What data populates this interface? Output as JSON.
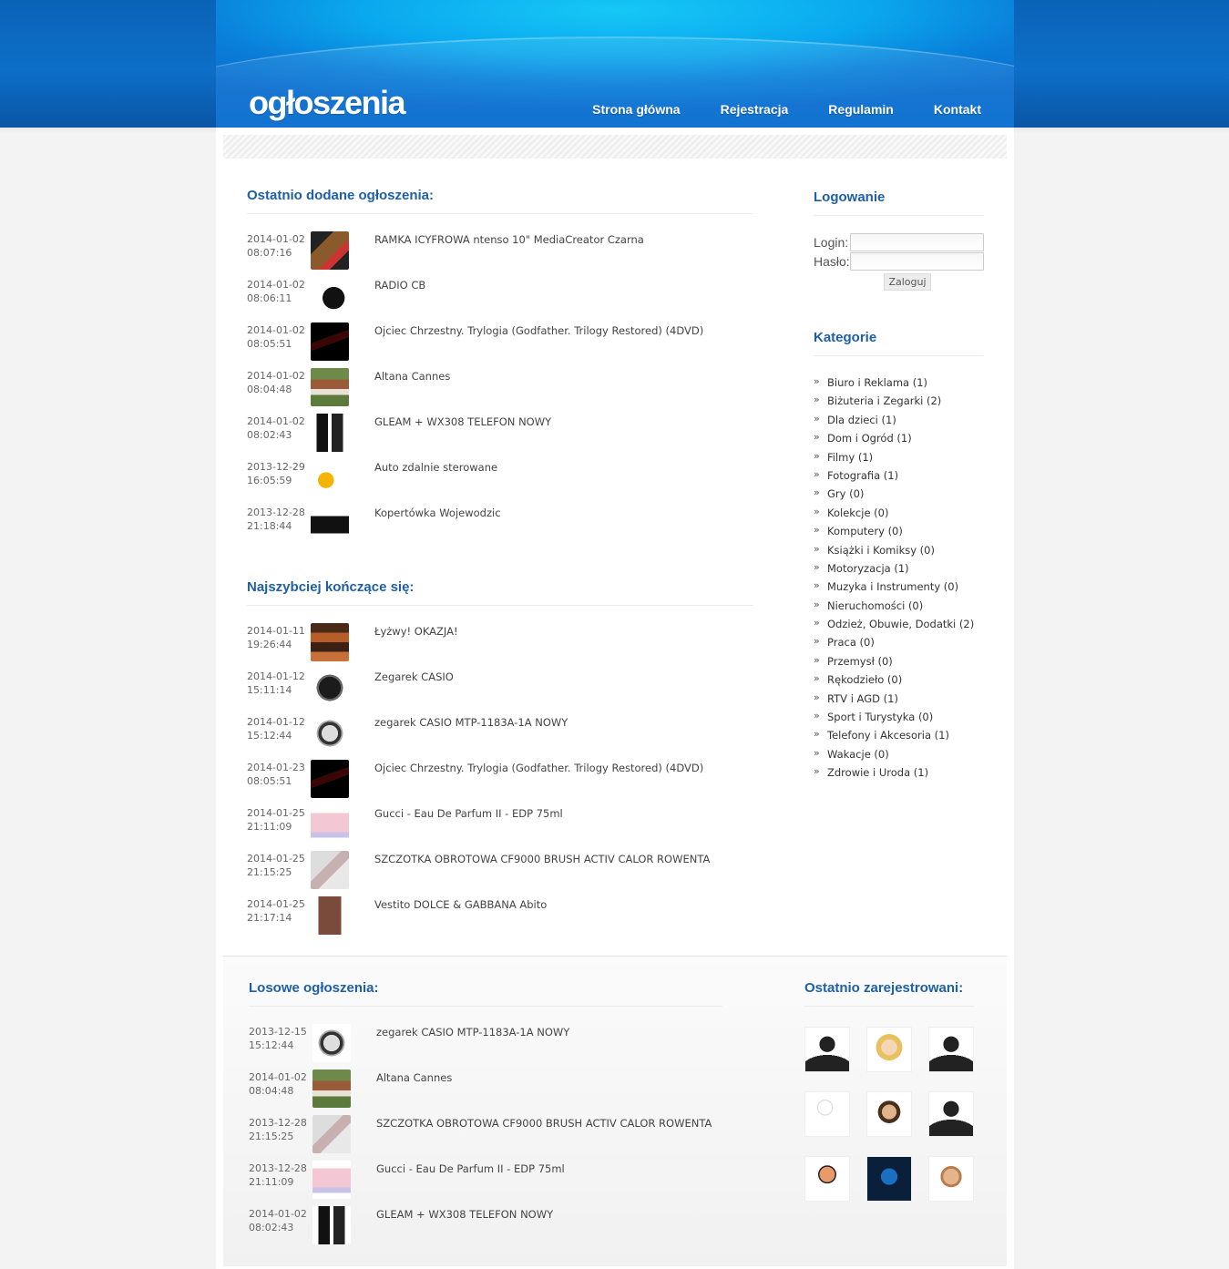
{
  "header": {
    "logo": "ogłoszenia",
    "nav": [
      "Strona główna",
      "Rejestracja",
      "Regulamin",
      "Kontakt"
    ]
  },
  "recent": {
    "title": "Ostatnio dodane ogłoszenia:",
    "items": [
      {
        "date": "2014-01-02",
        "time": "08:07:16",
        "title": "RAMKA ICYFROWA ntenso 10\" MediaCreator Czarna",
        "thumb": "frame"
      },
      {
        "date": "2014-01-02",
        "time": "08:06:11",
        "title": "RADIO CB",
        "thumb": "radio"
      },
      {
        "date": "2014-01-02",
        "time": "08:05:51",
        "title": "Ojciec Chrzestny. Trylogia (Godfather. Trilogy Restored) (4DVD)",
        "thumb": "dvd"
      },
      {
        "date": "2014-01-02",
        "time": "08:04:48",
        "title": "Altana Cannes",
        "thumb": "house"
      },
      {
        "date": "2014-01-02",
        "time": "08:02:43",
        "title": "GLEAM + WX308 TELEFON NOWY",
        "thumb": "phone"
      },
      {
        "date": "2013-12-29",
        "time": "16:05:59",
        "title": "Auto zdalnie sterowane",
        "thumb": "car"
      },
      {
        "date": "2013-12-28",
        "time": "21:18:44",
        "title": "Kopertówka Wojewodzic",
        "thumb": "wallet"
      }
    ]
  },
  "ending": {
    "title": "Najszybciej kończące się:",
    "items": [
      {
        "date": "2014-01-11",
        "time": "19:26:44",
        "title": "Łyżwy! OKAZJA!",
        "thumb": "skates"
      },
      {
        "date": "2014-01-12",
        "time": "15:11:14",
        "title": "Zegarek CASIO",
        "thumb": "watch"
      },
      {
        "date": "2014-01-12",
        "time": "15:12:44",
        "title": "zegarek CASIO MTP-1183A-1A NOWY",
        "thumb": "watch2"
      },
      {
        "date": "2014-01-23",
        "time": "08:05:51",
        "title": "Ojciec Chrzestny. Trylogia (Godfather. Trilogy Restored) (4DVD)",
        "thumb": "dvd"
      },
      {
        "date": "2014-01-25",
        "time": "21:11:09",
        "title": "Gucci - Eau De Parfum II - EDP 75ml",
        "thumb": "perfume"
      },
      {
        "date": "2014-01-25",
        "time": "21:15:25",
        "title": "SZCZOTKA OBROTOWA CF9000 BRUSH ACTIV CALOR ROWENTA",
        "thumb": "brush"
      },
      {
        "date": "2014-01-25",
        "time": "21:17:14",
        "title": "Vestito DOLCE & GABBANA Abito",
        "thumb": "dress"
      }
    ]
  },
  "random": {
    "title": "Losowe ogłoszenia:",
    "items": [
      {
        "date": "2013-12-15",
        "time": "15:12:44",
        "title": "zegarek CASIO MTP-1183A-1A NOWY",
        "thumb": "watch2"
      },
      {
        "date": "2014-01-02",
        "time": "08:04:48",
        "title": "Altana Cannes",
        "thumb": "house"
      },
      {
        "date": "2013-12-28",
        "time": "21:15:25",
        "title": "SZCZOTKA OBROTOWA CF9000 BRUSH ACTIV CALOR ROWENTA",
        "thumb": "brush"
      },
      {
        "date": "2013-12-28",
        "time": "21:11:09",
        "title": "Gucci - Eau De Parfum II - EDP 75ml",
        "thumb": "perfume"
      },
      {
        "date": "2014-01-02",
        "time": "08:02:43",
        "title": "GLEAM + WX308 TELEFON NOWY",
        "thumb": "phone"
      }
    ]
  },
  "login": {
    "title": "Logowanie",
    "login_label": "Login:",
    "password_label": "Hasło:",
    "login_value": "",
    "password_value": "",
    "submit": "Zaloguj"
  },
  "categories": {
    "title": "Kategorie",
    "items": [
      "Biuro i Reklama (1)",
      "Biżuteria i Zegarki (2)",
      "Dla dzieci (1)",
      "Dom i Ogród (1)",
      "Filmy (1)",
      "Fotografia (1)",
      "Gry (0)",
      "Kolekcje (0)",
      "Komputery (0)",
      "Książki i Komiksy (0)",
      "Motoryzacja (1)",
      "Muzyka i Instrumenty (0)",
      "Nieruchomości (0)",
      "Odzież, Obuwie, Dodatki (2)",
      "Praca (0)",
      "Przemysł (0)",
      "Rękodzieło (0)",
      "RTV i AGD (1)",
      "Sport i Turystyka (0)",
      "Telefony i Akcesoria (1)",
      "Wakacje (0)",
      "Zdrowie i Uroda (1)"
    ]
  },
  "registered": {
    "title": "Ostatnio zarejestrowani:",
    "avatars": [
      "silhouette",
      "blonde",
      "silhouette",
      "white",
      "cartoon",
      "silhouette",
      "kid",
      "avatar",
      "man"
    ]
  },
  "colors": {
    "accent": "#1e5fa6",
    "header_blue": "#0a7fd9"
  }
}
